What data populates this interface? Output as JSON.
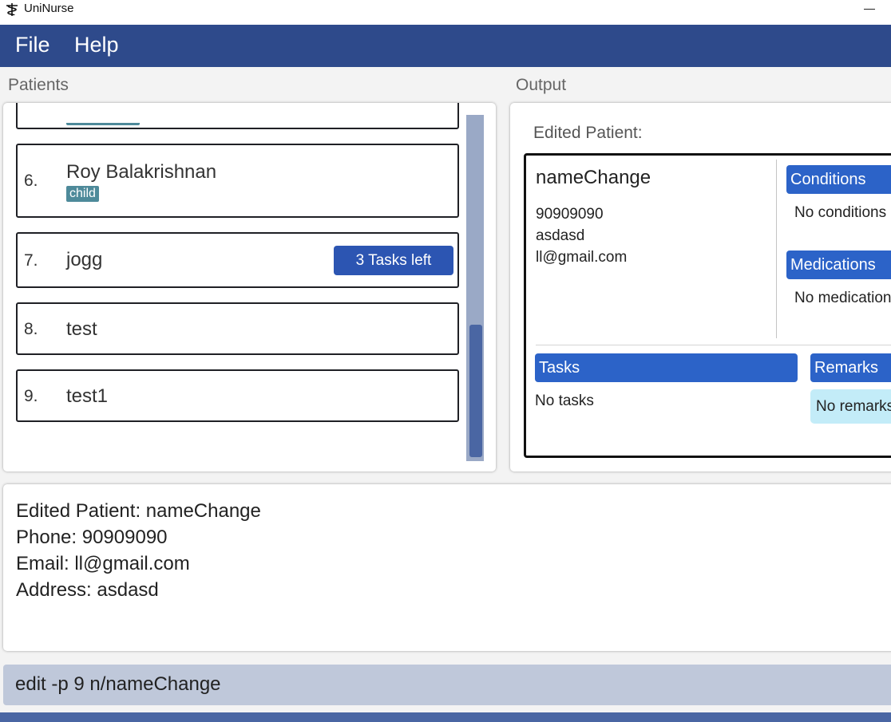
{
  "window": {
    "title": "UniNurse"
  },
  "menu": {
    "items": [
      "File",
      "Help"
    ]
  },
  "sections": {
    "patients": "Patients",
    "output": "Output"
  },
  "patients": [
    {
      "index": "6.",
      "name": "Roy Balakrishnan",
      "tag": "child"
    },
    {
      "index": "7.",
      "name": "jogg",
      "tasks_badge": "3 Tasks left"
    },
    {
      "index": "8.",
      "name": "test"
    },
    {
      "index": "9.",
      "name": "test1"
    }
  ],
  "scrollbar": {
    "position_fraction": 0.68
  },
  "output": {
    "heading": "Edited Patient:",
    "patient": {
      "name": "nameChange",
      "phone": "90909090",
      "address": "asdasd",
      "email": "ll@gmail.com",
      "conditions_header": "Conditions",
      "conditions_text": "No conditions",
      "medications_header": "Medications",
      "medications_text": "No medications",
      "tasks_header": "Tasks",
      "tasks_text": "No tasks",
      "remarks_header": "Remarks",
      "remarks_text": "No remarks"
    }
  },
  "result": {
    "lines": [
      "Edited Patient: nameChange",
      "Phone: 90909090",
      "Email: ll@gmail.com",
      "Address: asdasd"
    ]
  },
  "command": {
    "value": "edit -p 9 n/nameChange"
  },
  "colors": {
    "menubar": "#2e4a8b",
    "accent_blue": "#2c63c8",
    "badge_blue": "#2c55b2",
    "tag_teal": "#4e8a9a",
    "remarks_bg": "#c3ecf8",
    "command_bg": "#bfc8da"
  }
}
